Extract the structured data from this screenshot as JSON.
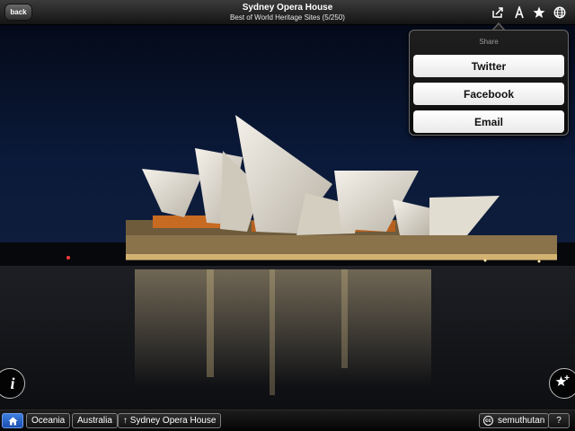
{
  "header": {
    "back_label": "back",
    "title": "Sydney Opera House",
    "subtitle": "Best of World Heritage Sites (5/250)"
  },
  "toolbar_icons": [
    "share-icon",
    "font-size-icon",
    "star-icon",
    "globe-icon"
  ],
  "share_popover": {
    "title": "Share",
    "options": [
      "Twitter",
      "Facebook",
      "Email"
    ]
  },
  "floating": {
    "info_icon": "info-icon",
    "favorite_icon": "star-add-icon"
  },
  "breadcrumb": {
    "home_icon": "home-icon",
    "items": [
      "Oceania",
      "Australia",
      "↑ Sydney Opera House"
    ]
  },
  "credit": {
    "icon": "creative-commons-icon",
    "author": "semuthutan"
  },
  "help_label": "?",
  "colors": {
    "accent": "#2a62c9",
    "sky": "#0a1630",
    "water": "#15171c"
  }
}
